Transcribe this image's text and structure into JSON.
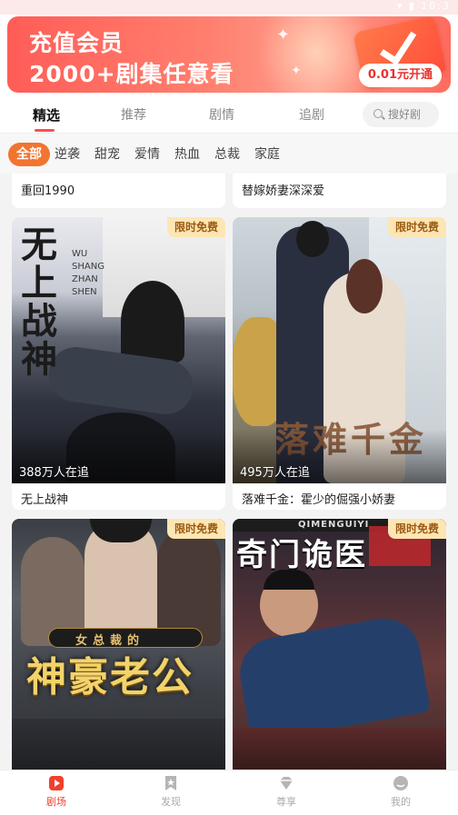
{
  "banner": {
    "line1": "充值会员",
    "line2": "2000+剧集任意看",
    "pay_button": "0.01元开通"
  },
  "main_tabs": [
    {
      "label": "精选",
      "active": true
    },
    {
      "label": "推荐",
      "active": false
    },
    {
      "label": "剧情",
      "active": false
    },
    {
      "label": "追剧",
      "active": false
    }
  ],
  "search": {
    "placeholder": "搜好剧"
  },
  "categories": [
    {
      "label": "全部",
      "active": true
    },
    {
      "label": "逆袭"
    },
    {
      "label": "甜宠"
    },
    {
      "label": "爱情"
    },
    {
      "label": "热血"
    },
    {
      "label": "总裁"
    },
    {
      "label": "家庭"
    }
  ],
  "top_cards": [
    {
      "title": "重回1990"
    },
    {
      "title": "替嫁娇妻深深爱"
    }
  ],
  "cards": [
    {
      "title": "无上战神",
      "badge": "限时免费",
      "watchers": "388万人在追",
      "poster_text": "无上战神",
      "poster_sub": "WU SHANG ZHAN SHEN"
    },
    {
      "title": "落难千金：霍少的倔强小娇妻",
      "badge": "限时免费",
      "watchers": "495万人在追",
      "poster_text": "落难千金"
    },
    {
      "title": "",
      "badge": "限时免费",
      "watchers": "",
      "poster_text": "神豪老公",
      "poster_sub": "女总裁的"
    },
    {
      "title": "",
      "badge": "限时免费",
      "watchers": "",
      "poster_text": "奇门诡医",
      "poster_sub": "QIMENGUIYI"
    }
  ],
  "bottom_nav": [
    {
      "label": "剧场",
      "icon": "play-icon",
      "active": true
    },
    {
      "label": "发现",
      "icon": "bookmark-star-icon",
      "active": false
    },
    {
      "label": "尊享",
      "icon": "diamond-icon",
      "active": false
    },
    {
      "label": "我的",
      "icon": "profile-icon",
      "active": false
    }
  ],
  "colors": {
    "accent": "#f27430",
    "brand_red": "#f2402e",
    "badge_bg": "#fde6b4"
  }
}
